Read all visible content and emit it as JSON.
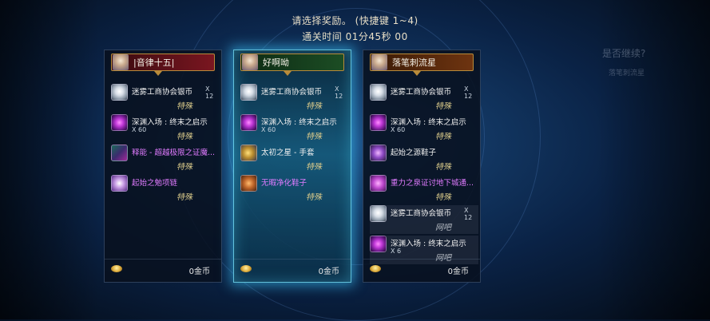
{
  "header": {
    "prompt": "请选择奖励。 (快捷键 1~4)",
    "clear_time": "通关时间   01分45秒 00"
  },
  "panels": [
    {
      "name": "|音律十五|",
      "items": [
        {
          "icon": "silver-coin-icon",
          "name": "迷雾工商协会银币",
          "qty": "X 12",
          "rarity": "特殊"
        },
        {
          "icon": "abyss-ticket-icon",
          "name": "深渊入场 : 终末之启示",
          "qty": "X 60",
          "rarity": "特殊"
        },
        {
          "icon": "shard-icon",
          "name": "释能 - 超越极限之证魔...",
          "qty": "",
          "rarity": "特殊"
        },
        {
          "icon": "necklace-icon",
          "name": "起始之勉项链",
          "qty": "",
          "rarity": "特殊"
        }
      ],
      "gold": "0金币"
    },
    {
      "name": "好啊呦",
      "items": [
        {
          "icon": "silver-coin-icon",
          "name": "迷雾工商协会银币",
          "qty": "X 12",
          "rarity": "特殊"
        },
        {
          "icon": "abyss-ticket-icon",
          "name": "深渊入场 : 终末之启示",
          "qty": "X 60",
          "rarity": "特殊"
        },
        {
          "icon": "glove-icon",
          "name": "太初之星 - 手套",
          "qty": "",
          "rarity": "特殊"
        },
        {
          "icon": "shoe-icon",
          "name": "无暇净化鞋子",
          "qty": "",
          "rarity": "特殊"
        }
      ],
      "gold": "0金币"
    },
    {
      "name": "落笔刺流星",
      "items": [
        {
          "icon": "silver-coin-icon",
          "name": "迷雾工商协会银币",
          "qty": "X 12",
          "rarity": "特殊"
        },
        {
          "icon": "abyss-ticket-icon",
          "name": "深渊入场 : 终末之启示",
          "qty": "X 60",
          "rarity": "特殊"
        },
        {
          "icon": "boot-icon",
          "name": "起始之源鞋子",
          "qty": "",
          "rarity": "特殊"
        },
        {
          "icon": "gravity-orb-icon",
          "name": "重力之泉证讨地下城通...",
          "qty": "",
          "rarity": "特殊"
        },
        {
          "icon": "silver-coin-icon",
          "name": "迷雾工商协会银币",
          "qty": "X 12",
          "rarity": "网吧"
        },
        {
          "icon": "abyss-ticket-icon",
          "name": "深渊入场 : 终末之启示",
          "qty": "X 6",
          "rarity": "网吧"
        }
      ],
      "gold": "0金币"
    }
  ],
  "background": {
    "side_text": "是否继续?",
    "side_text2": "落笔刺流星"
  }
}
